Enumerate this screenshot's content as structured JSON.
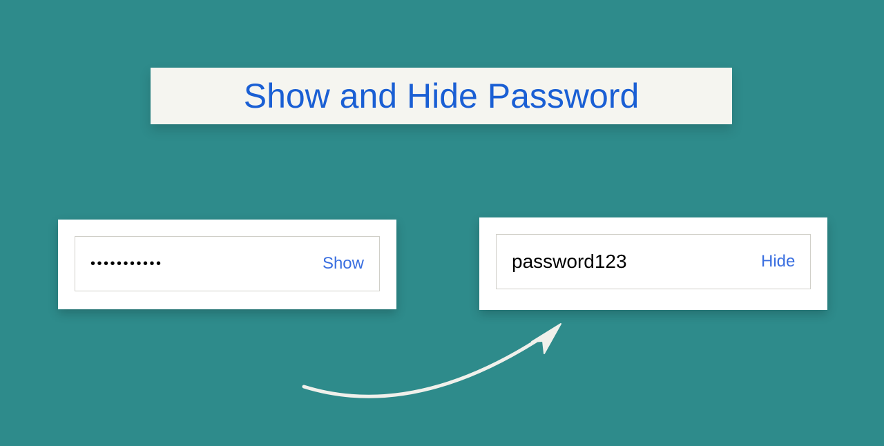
{
  "title": "Show and Hide Password",
  "left": {
    "masked_value": "•••••••••••",
    "toggle_label": "Show"
  },
  "right": {
    "plain_value": "password123",
    "toggle_label": "Hide"
  }
}
